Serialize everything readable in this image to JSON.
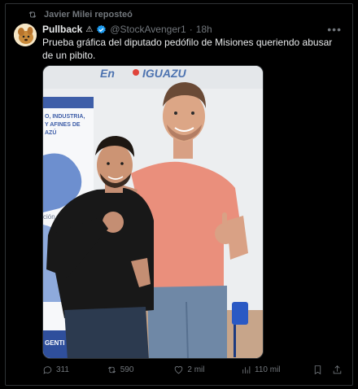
{
  "repost": {
    "text": "Javier Milei reposteó",
    "icon": "repost-icon"
  },
  "author": {
    "name": "Pullback",
    "badge_symbol": "⚠",
    "handle": "@StockAvenger1",
    "separator": "·",
    "time": "18h"
  },
  "tweet": {
    "text": "Prueba gráfica del diputado pedófilo de Misiones queriendo abusar de un pibito."
  },
  "media": {
    "banner_text_en": "En",
    "banner_text_city": "IGUAZU",
    "poster_lines": [
      "O, INDUSTRIA,",
      "Y AFINES DE",
      "AZÚ"
    ],
    "poster_bottom": "GENTI",
    "side_text": "ción"
  },
  "actions": {
    "replies": "311",
    "reposts": "590",
    "likes": "2 mil",
    "views": "110 mil"
  },
  "colors": {
    "accent_blue": "#1d9bf0",
    "muted": "#71767b",
    "background": "#000000",
    "text": "#e7e9ea"
  }
}
